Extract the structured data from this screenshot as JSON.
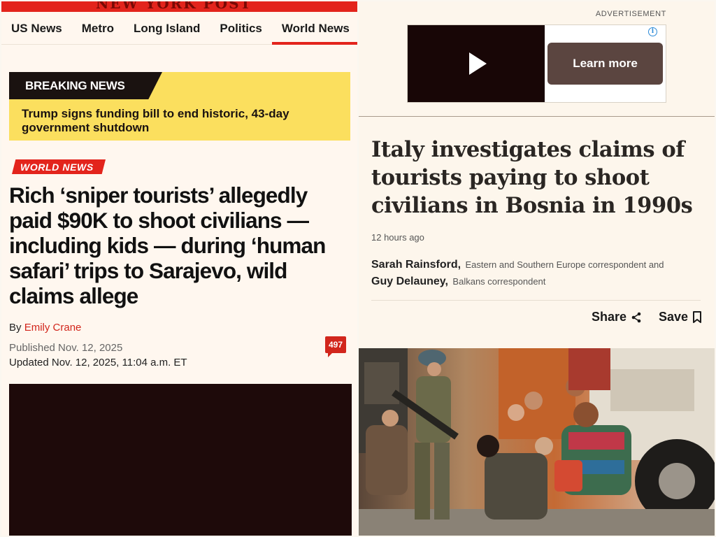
{
  "left": {
    "masthead_logo": "NEW YORK POST",
    "nav": [
      "US News",
      "Metro",
      "Long Island",
      "Politics",
      "World News"
    ],
    "breaking_label": "BREAKING NEWS",
    "breaking_text": "Trump signs funding bill to end historic, 43-day government shutdown",
    "section": "WORLD NEWS",
    "headline": "Rich ‘sniper tourists’ allegedly paid $90K to shoot civilians — including kids — during ‘human safari’ trips to Sarajevo, wild claims allege",
    "by_prefix": "By ",
    "author": "Emily Crane",
    "published": "Published Nov. 12, 2025",
    "updated": "Updated Nov. 12, 2025, 11:04 a.m. ET",
    "comment_count": "497"
  },
  "right": {
    "ad_label": "ADVERTISEMENT",
    "ad_cta": "Learn more",
    "headline": "Italy investigates claims of tourists paying to shoot civilians in Bosnia in 1990s",
    "timestamp": "12 hours ago",
    "author1_name": "Sarah Rainsford,",
    "author1_role": "Eastern and Southern Europe correspondent and",
    "author2_name": "Guy Delauney,",
    "author2_role": "Balkans correspondent",
    "share": "Share",
    "save": "Save"
  },
  "colors": {
    "nypost_red": "#e3241c",
    "breaking_yellow": "#fbdf5e",
    "bbc_bg": "#fdf6ec",
    "ad_button": "#5b4540"
  }
}
